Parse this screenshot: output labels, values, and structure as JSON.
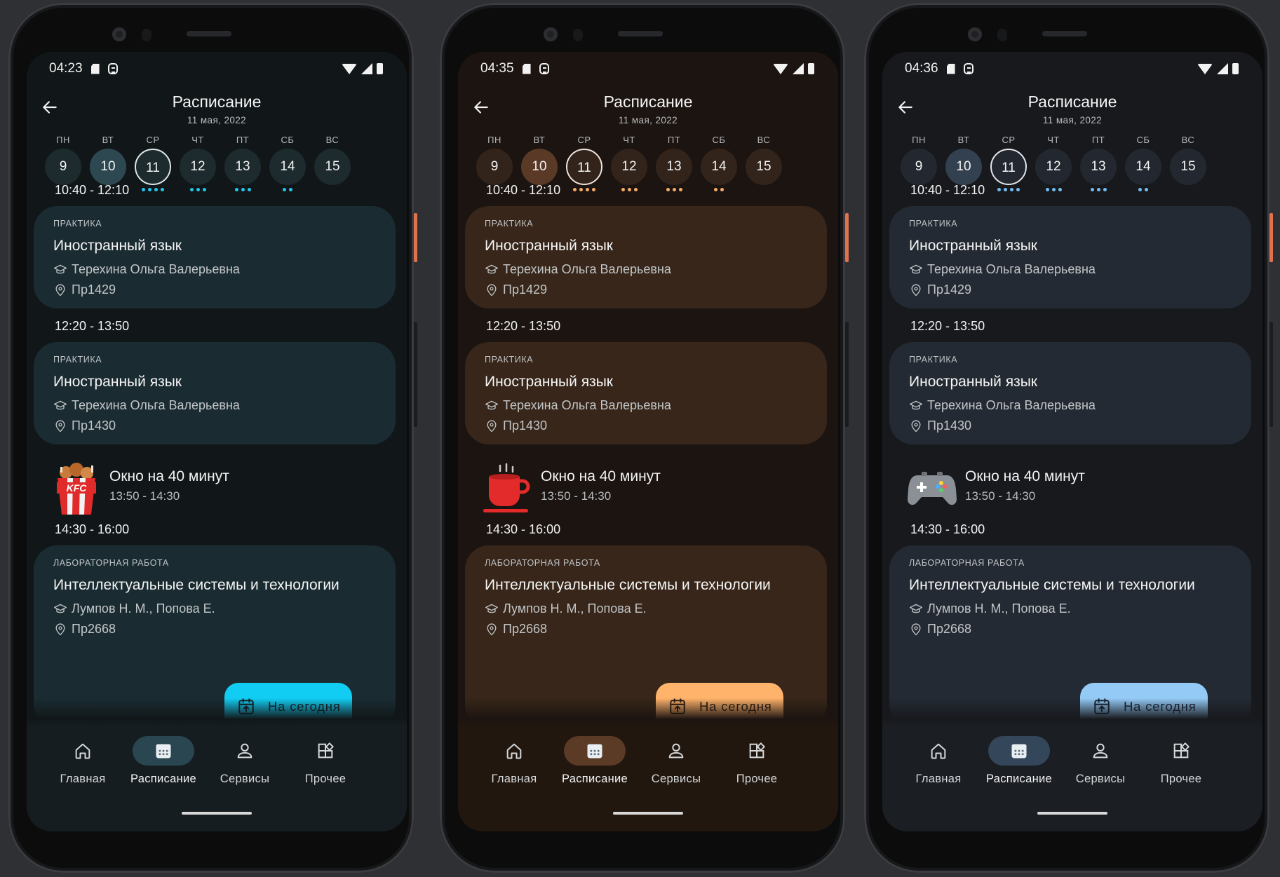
{
  "phones": [
    {
      "theme": "teal",
      "status": {
        "time": "04:23"
      },
      "break_art": "fast-food-bucket-icon"
    },
    {
      "theme": "brown",
      "status": {
        "time": "04:35"
      },
      "break_art": "coffee-cup-icon"
    },
    {
      "theme": "grey",
      "status": {
        "time": "04:36"
      },
      "break_art": "gamepad-icon"
    }
  ],
  "header": {
    "title": "Расписание",
    "date": "11 мая, 2022"
  },
  "week": [
    {
      "wd": "ПН",
      "num": "9",
      "dots": 0
    },
    {
      "wd": "ВТ",
      "num": "10",
      "dots": 0
    },
    {
      "wd": "СР",
      "num": "11",
      "dots": 4
    },
    {
      "wd": "ЧТ",
      "num": "12",
      "dots": 3
    },
    {
      "wd": "ПТ",
      "num": "13",
      "dots": 3
    },
    {
      "wd": "СБ",
      "num": "14",
      "dots": 2
    },
    {
      "wd": "ВС",
      "num": "15",
      "dots": 0
    }
  ],
  "lessons": [
    {
      "time": "10:40 - 12:10",
      "type": "ПРАКТИКА",
      "name": "Иностранный язык",
      "teacher": "Терехина Ольга Валерьевна",
      "room": "Пр1429"
    },
    {
      "time": "12:20 - 13:50",
      "type": "ПРАКТИКА",
      "name": "Иностранный язык",
      "teacher": "Терехина Ольга Валерьевна",
      "room": "Пр1430"
    },
    {
      "time": "14:30 - 16:00",
      "type": "ЛАБОРАТОРНАЯ РАБОТА",
      "name": "Интеллектуальные системы и технологии",
      "teacher": "Лумпов Н. М., Попова Е.",
      "room": "Пр2668"
    }
  ],
  "break": {
    "title": "Окно на 40 минут",
    "time": "13:50 - 14:30"
  },
  "fab": {
    "label": "На сегодня"
  },
  "nav": [
    {
      "label": "Главная",
      "icon": "home-icon"
    },
    {
      "label": "Расписание",
      "icon": "calendar-icon",
      "active": true
    },
    {
      "label": "Сервисы",
      "icon": "person-icon"
    },
    {
      "label": "Прочее",
      "icon": "widgets-icon"
    }
  ],
  "colors": {
    "teal_accent": "#12cdf3",
    "brown_accent": "#ffb36b",
    "grey_accent": "#94caf6"
  }
}
